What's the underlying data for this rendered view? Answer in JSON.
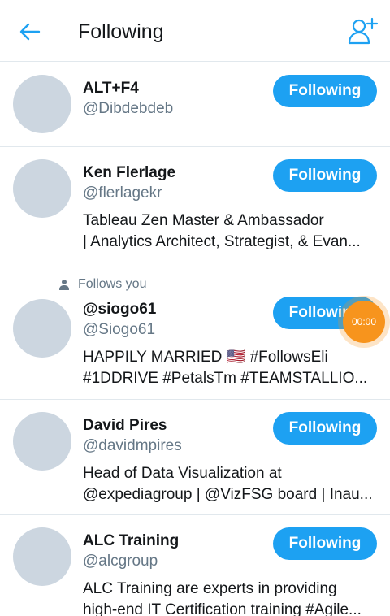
{
  "header": {
    "title": "Following"
  },
  "colors": {
    "accent": "#1da1f2",
    "timer": "#f7941d"
  },
  "users": [
    {
      "name": "ALT+F4",
      "handle": "@Dibdebdeb",
      "bio": [],
      "button": "Following",
      "follows_you": ""
    },
    {
      "name": "Ken Flerlage",
      "handle": "@flerlagekr",
      "bio": [
        "Tableau Zen Master & Ambassador",
        "| Analytics Architect, Strategist, & Evan..."
      ],
      "button": "Following",
      "follows_you": ""
    },
    {
      "name": "@siogo61",
      "handle": "@Siogo61",
      "bio": [
        "HAPPILY MARRIED 🇺🇸 #FollowsEli",
        "#1DDRIVE #PetalsTm #TEAMSTALLIO..."
      ],
      "button": "Following",
      "follows_you": "Follows you"
    },
    {
      "name": "David Pires",
      "handle": "@davidmpires",
      "bio": [
        "Head of Data Visualization at",
        "@expediagroup | @VizFSG board | Inau..."
      ],
      "button": "Following",
      "follows_you": ""
    },
    {
      "name": "ALC Training",
      "handle": "@alcgroup",
      "bio": [
        "ALC Training are experts in providing",
        "high-end IT Certification training #Agile..."
      ],
      "button": "Following",
      "follows_you": ""
    }
  ],
  "overlay": {
    "timer_text": "00:00"
  }
}
